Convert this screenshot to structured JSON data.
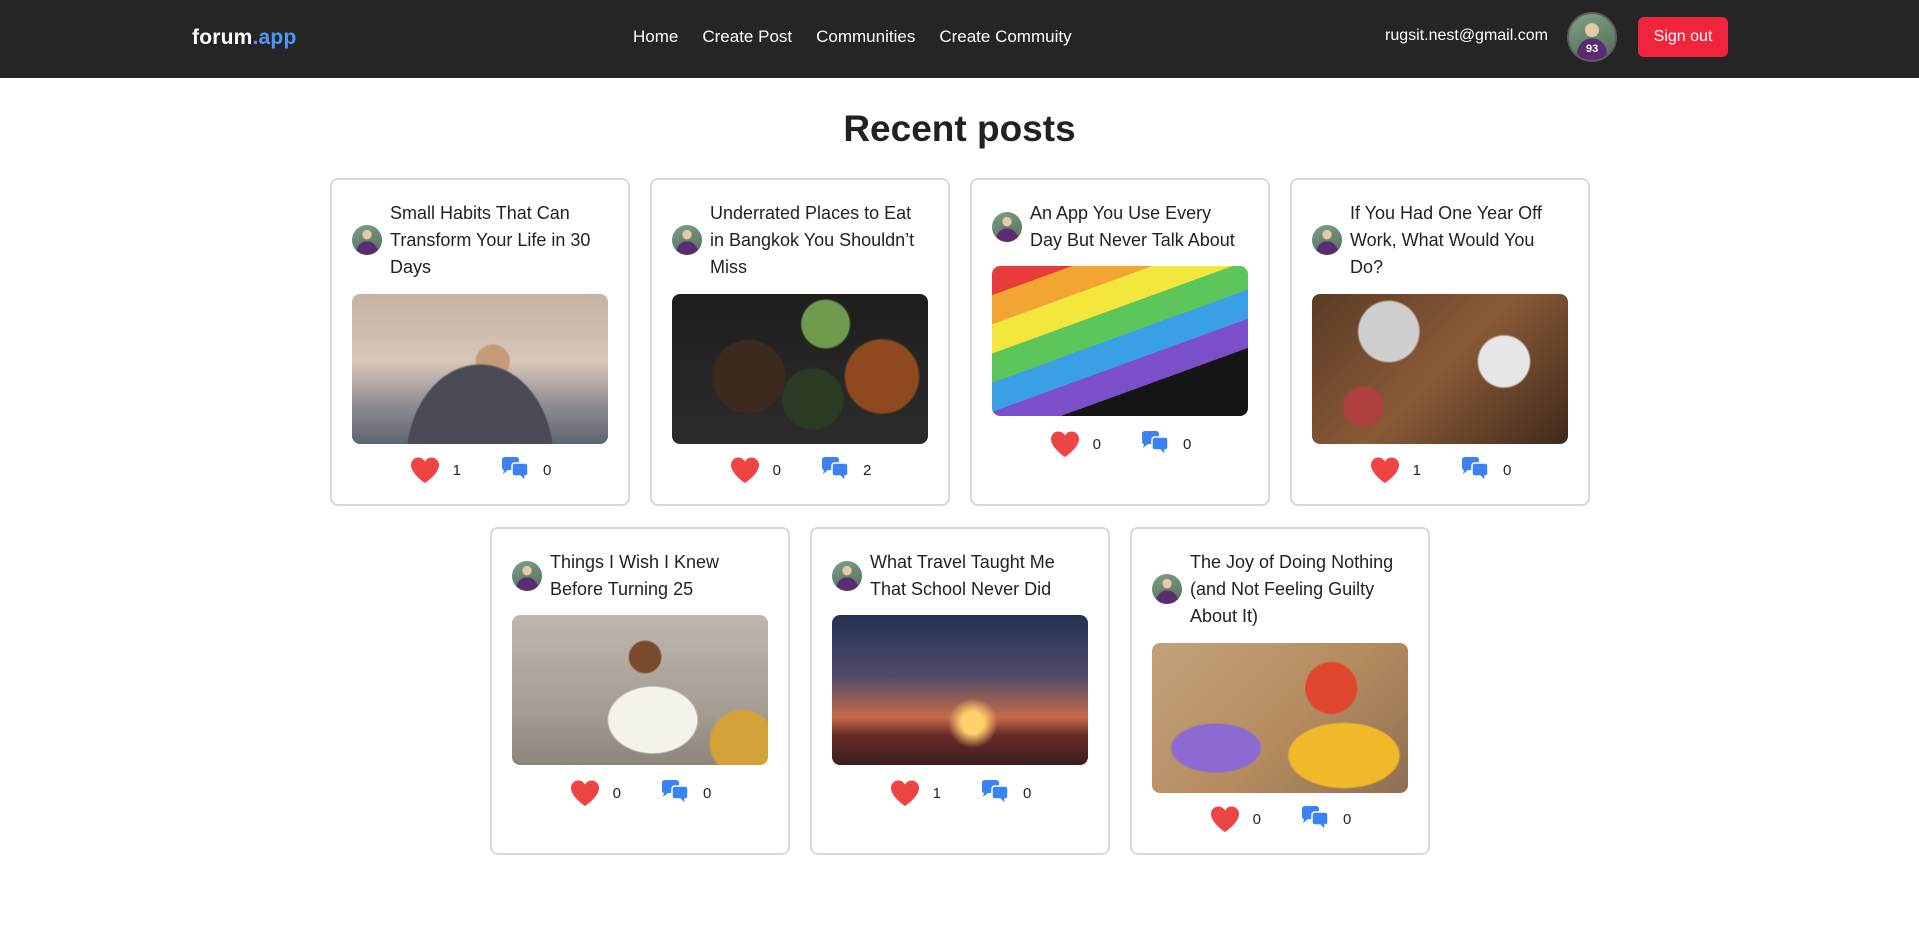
{
  "navbar": {
    "brand_part1": "forum",
    "brand_part2": ".app",
    "links": [
      "Home",
      "Create Post",
      "Communities",
      "Create Commuity"
    ],
    "user_email": "rugsit.nest@gmail.com",
    "avatar_number": "93",
    "signout_label": "Sign out",
    "signout_color": "#f0243b"
  },
  "page_title": "Recent posts",
  "posts": [
    {
      "title": "Small Habits That Can Transform Your Life in 30 Days",
      "likes": "1",
      "comments": "0",
      "image": "sunset-hiker"
    },
    {
      "title": "Underrated Places to Eat in Bangkok You Shouldn’t Miss",
      "likes": "0",
      "comments": "2",
      "image": "thai-food"
    },
    {
      "title": "An App You Use Every Day But Never Talk About",
      "likes": "0",
      "comments": "0",
      "image": "app-grid"
    },
    {
      "title": "If You Had One Year Off Work, What Would You Do?",
      "likes": "1",
      "comments": "0",
      "image": "work-desk"
    },
    {
      "title": "Things I Wish I Knew Before Turning 25",
      "likes": "0",
      "comments": "0",
      "image": "woman-couch"
    },
    {
      "title": "What Travel Taught Me That School Never Did",
      "likes": "1",
      "comments": "0",
      "image": "travel-sunset"
    },
    {
      "title": "The Joy of Doing Nothing (and Not Feeling Guilty About It)",
      "likes": "0",
      "comments": "0",
      "image": "artist"
    }
  ],
  "icons": {
    "like": "heart-icon",
    "comment": "comment-bubbles-icon"
  },
  "colors": {
    "heart": "#ef4444",
    "comment": "#3b82f6",
    "link_accent": "#4f97ff"
  }
}
